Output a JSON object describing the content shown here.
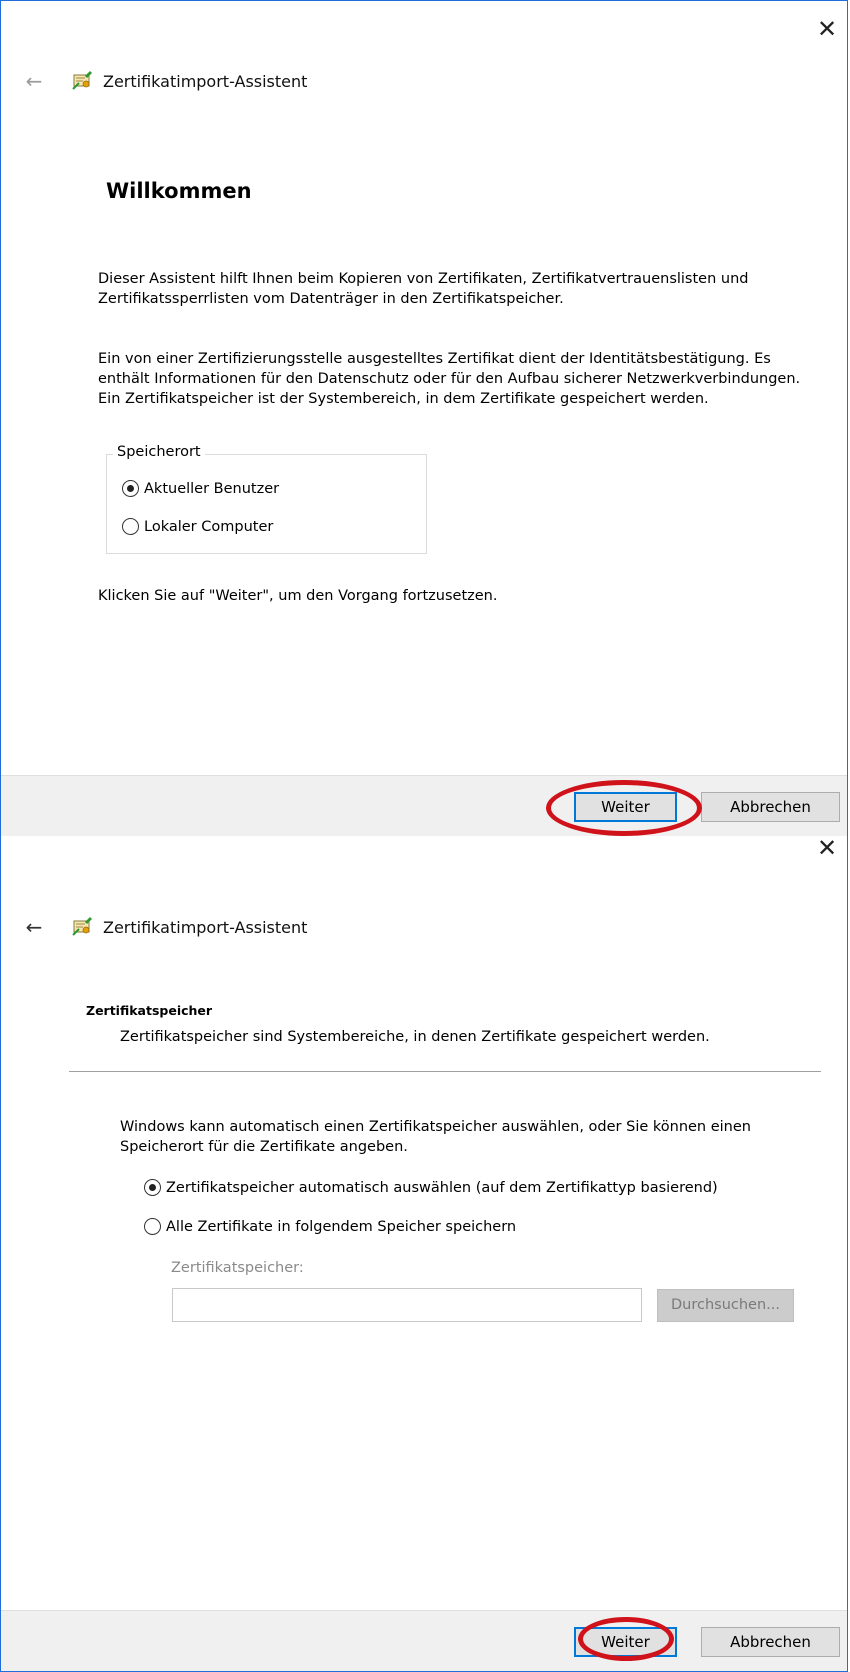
{
  "wizard_title": "Zertifikatimport-Assistent",
  "close_glyph": "✕",
  "back_glyph": "←",
  "step1": {
    "heading": "Willkommen",
    "paragraph1": "Dieser Assistent hilft Ihnen beim Kopieren von Zertifikaten, Zertifikatvertrauenslisten und Zertifikatssperrlisten vom Datenträger in den Zertifikatspeicher.",
    "paragraph2": "Ein von einer Zertifizierungsstelle ausgestelltes Zertifikat dient der Identitätsbestätigung. Es enthält Informationen für den Datenschutz oder für den Aufbau sicherer Netzwerkverbindungen. Ein Zertifikatspeicher ist der Systembereich, in dem Zertifikate gespeichert werden.",
    "location_group_label": "Speicherort",
    "options": [
      {
        "label": "Aktueller Benutzer",
        "selected": true
      },
      {
        "label": "Lokaler Computer",
        "selected": false
      }
    ],
    "continue_hint": "Klicken Sie auf \"Weiter\", um den Vorgang fortzusetzen.",
    "next_label": "Weiter",
    "cancel_label": "Abbrechen"
  },
  "step2": {
    "heading": "Zertifikatspeicher",
    "subheading": "Zertifikatspeicher sind Systembereiche, in denen Zertifikate gespeichert werden.",
    "paragraph1": "Windows kann automatisch einen Zertifikatspeicher auswählen, oder Sie können einen Speicherort für die Zertifikate angeben.",
    "options": [
      {
        "label": "Zertifikatspeicher automatisch auswählen (auf dem Zertifikattyp basierend)",
        "selected": true
      },
      {
        "label": "Alle Zertifikate in folgendem Speicher speichern",
        "selected": false
      }
    ],
    "store_field_label": "Zertifikatspeicher:",
    "store_field_value": "",
    "browse_label": "Durchsuchen...",
    "next_label": "Weiter",
    "cancel_label": "Abbrechen"
  },
  "colors": {
    "accent_border": "#0078d7",
    "highlight_ring": "#d0121b",
    "footer_bg": "#f0f0f0"
  }
}
